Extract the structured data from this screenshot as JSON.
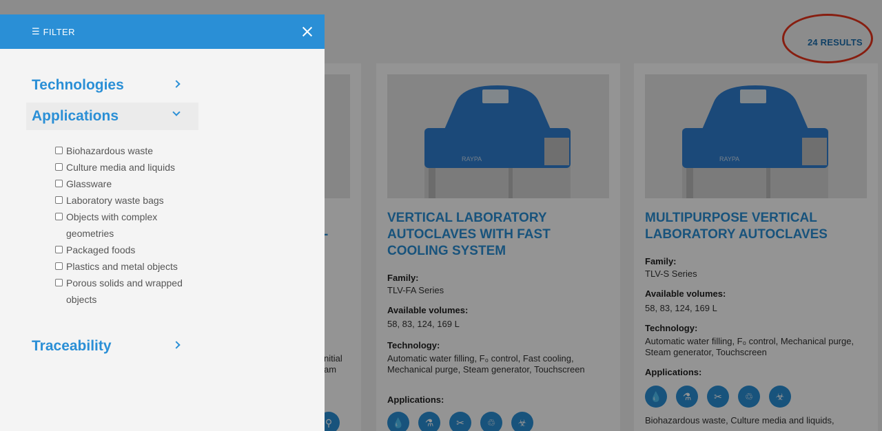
{
  "results": {
    "label": "24 RESULTS"
  },
  "filter": {
    "title": "FILTER",
    "sections": [
      {
        "label": "Technologies",
        "expanded": false
      },
      {
        "label": "Applications",
        "expanded": true
      },
      {
        "label": "Traceability",
        "expanded": false
      }
    ],
    "options": [
      "Biohazardous waste",
      "Culture media and liquids",
      "Glassware",
      "Laboratory waste bags",
      "Objects with complex geometries",
      "Packaged foods",
      "Plastics and metal objects",
      "Porous solids and wrapped objects"
    ]
  },
  "cards": [
    {
      "title": "VERTICAL LABORATORY AUTOCLAVES WITH FAST COOLING SYSTEM",
      "family_label": "Family:",
      "family": "TLV-FA Series",
      "volumes_label": "Available volumes:",
      "volumes": "58, 83, 124, 169 L",
      "technology_label": "Technology:",
      "technology": "Automatic water filling, F₀ control, Fast cooling, Mechanical purge, Steam generator, Touchscreen",
      "applications_label": "Applications:"
    },
    {
      "title": "MULTIPURPOSE VERTICAL LABORATORY AUTOCLAVES",
      "family_label": "Family:",
      "family": "TLV-S Series",
      "volumes_label": "Available volumes:",
      "volumes": "58, 83, 124, 169 L",
      "technology_label": "Technology:",
      "technology": "Automatic water filling, F₀ control, Mechanical purge, Steam generator, Touchscreen",
      "applications_label": "Applications:",
      "applications_text": "Biohazardous waste, Culture media and liquids,"
    }
  ],
  "partial_card": {
    "frag1": "-",
    "frag2": "nitial",
    "frag3": "am"
  },
  "brand": "RAYPA",
  "colors": {
    "primary": "#2a8fd6",
    "title_blue": "#1c6fae",
    "highlight": "#e8341c"
  },
  "icons": [
    "drop-icon",
    "flask-icon",
    "scissors-icon",
    "waste-bag-icon",
    "biohazard-icon"
  ]
}
